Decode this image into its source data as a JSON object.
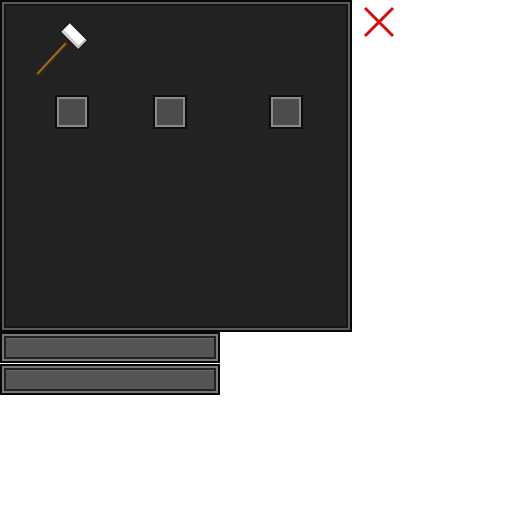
{
  "window": {
    "tool_icon": "hammer-icon",
    "close_icon": "close-icon",
    "close_color": "#d01010"
  },
  "slots": [
    {
      "id": "slot-1",
      "contents": ""
    },
    {
      "id": "slot-2",
      "contents": ""
    },
    {
      "id": "slot-3",
      "contents": ""
    }
  ],
  "bars": [
    {
      "id": "bar-1",
      "label": ""
    },
    {
      "id": "bar-2",
      "label": ""
    }
  ]
}
